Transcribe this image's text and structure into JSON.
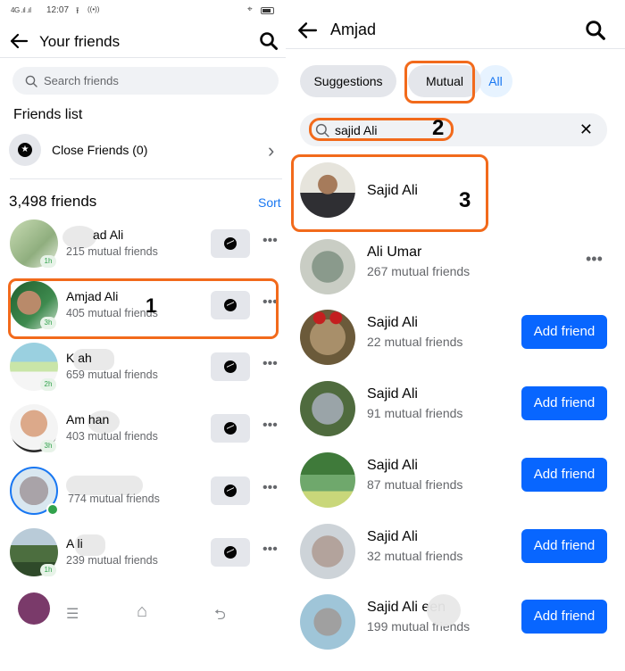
{
  "left": {
    "status_bar": {
      "signal": "4G .ıl .ıl",
      "time": "12:07",
      "upload_icon": "upload-arrow-icon",
      "nfc_icon": "nfc-icon",
      "location_icon": "location-pin-icon",
      "battery_icon": "battery-icon"
    },
    "header": {
      "title": "Your friends",
      "back_icon": "back-arrow-icon",
      "search_icon": "search-icon"
    },
    "search": {
      "placeholder": "Search friends"
    },
    "friends_list_title": "Friends list",
    "close_friends": {
      "label": "Close Friends (0)",
      "icon": "star-icon"
    },
    "friend_count": "3,498 friends",
    "sort_label": "Sort",
    "friends": [
      {
        "name": "Amjad Ali",
        "name_obscured": true,
        "visible_name": "ad Ali",
        "mutual": "215 mutual friends",
        "badge": "1h",
        "online": false,
        "avatar_color": "#a9c39a"
      },
      {
        "name": "Amjad Ali",
        "mutual": "405 mutual friends",
        "badge": "3h",
        "online": false,
        "highlighted": true,
        "step": "1",
        "avatar_color": "#2e6b3a"
      },
      {
        "name": "K...ah",
        "visible_name": "K          ah",
        "mutual": "659 mutual friends",
        "badge": "2h",
        "online": false,
        "avatar_color": "#b8d6a0"
      },
      {
        "name": "Am...han",
        "visible_name": "Am          han",
        "mutual": "403 mutual friends",
        "badge": "3h",
        "online": false,
        "avatar_color": "#d9a98a"
      },
      {
        "name": "",
        "visible_name": "",
        "mutual": "774 mutual friends",
        "badge": "",
        "online": true,
        "story_ring": true,
        "avatar_color": "#9aa8b5"
      },
      {
        "name": "A...li",
        "visible_name": "A        li",
        "mutual": "239 mutual friends",
        "badge": "1h",
        "online": false,
        "avatar_color": "#6f8f6a"
      }
    ],
    "message_icon": "messenger-icon",
    "more_icon": "more-dots-icon",
    "more_label": "•••",
    "nav": {
      "menu": "☰",
      "home": "⌂",
      "back": "⮌"
    }
  },
  "right": {
    "header": {
      "title": "Amjad",
      "back_icon": "back-arrow-icon",
      "search_icon": "search-icon"
    },
    "chips": [
      {
        "label": "Suggestions",
        "active": false
      },
      {
        "label": "Mutual",
        "active": false,
        "highlighted": true
      },
      {
        "label": "All",
        "active": true
      }
    ],
    "search": {
      "value": "sajid Ali",
      "step": "2",
      "clear_icon": "close-icon",
      "clear_label": "✕"
    },
    "results": [
      {
        "name": "Sajid Ali",
        "mutual": "",
        "action": "",
        "highlighted": true,
        "step": "3",
        "avatar_color": "#7a7f86"
      },
      {
        "name": "Ali Umar",
        "mutual": "267 mutual friends",
        "action": "more",
        "avatar_color": "#8a9a8c"
      },
      {
        "name": "Sajid Ali",
        "mutual": "22 mutual friends",
        "action": "Add friend",
        "avatar_color": "#a88f6a"
      },
      {
        "name": "Sajid Ali",
        "mutual": "91 mutual friends",
        "action": "Add friend",
        "avatar_color": "#8d9a8a"
      },
      {
        "name": "Sajid Ali",
        "mutual": "87 mutual friends",
        "action": "Add friend",
        "avatar_color": "#6f9f70"
      },
      {
        "name": "Sajid Ali",
        "mutual": "32 mutual friends",
        "action": "Add friend",
        "avatar_color": "#a8a4a0"
      },
      {
        "name": "Sajid Ali ...een",
        "visible_name": "Sajid Ali          een",
        "mutual": "199 mutual friends",
        "action": "Add friend",
        "avatar_color": "#8aa0b0"
      }
    ],
    "add_friend_label": "Add friend",
    "more_label": "•••"
  },
  "colors": {
    "highlight": "#f26a1b",
    "primary": "#0866ff",
    "link": "#1877f2",
    "chip_bg": "#e4e6eb",
    "active_chip_bg": "#e7f3ff",
    "secondary_text": "#65676b",
    "online": "#31a24c"
  }
}
